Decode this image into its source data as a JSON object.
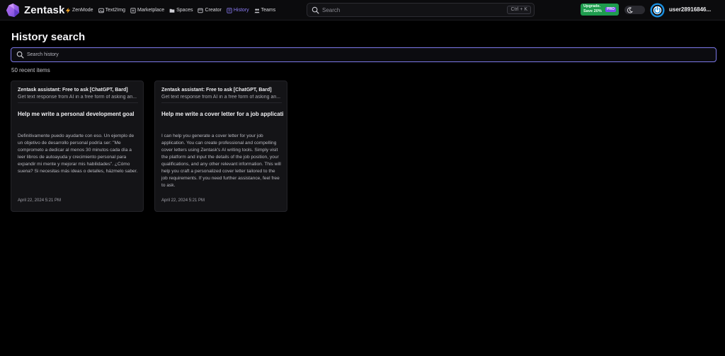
{
  "app": {
    "brand": "Zentask",
    "accent": "#8b7cf6"
  },
  "nav": {
    "items": [
      {
        "label": "ZenMode",
        "icon": "bolt-icon",
        "active": false
      },
      {
        "label": "Text2Img",
        "icon": "image-icon",
        "active": false
      },
      {
        "label": "Marketplace",
        "icon": "marketplace-icon",
        "active": false
      },
      {
        "label": "Spaces",
        "icon": "folder-icon",
        "active": false
      },
      {
        "label": "Creator",
        "icon": "creator-icon",
        "active": false
      },
      {
        "label": "History",
        "icon": "history-icon",
        "active": true
      },
      {
        "label": "Teams",
        "icon": "teams-icon",
        "active": false
      }
    ]
  },
  "search": {
    "placeholder": "Search",
    "shortcut": "Ctrl + K"
  },
  "upgrade": {
    "line1": "Upgrade.",
    "line2": "Save 20%",
    "badge": "PRO",
    "color": "#1e9c4e"
  },
  "user": {
    "name": "user28916846...",
    "avatar_color": "#1a8fe0"
  },
  "page": {
    "title": "History search",
    "search_placeholder": "Search history",
    "count_label": "50 recent items"
  },
  "history": [
    {
      "tool": "Zentask assistant: Free to ask [ChatGPT, Bard]",
      "tool_desc": "Get text response from AI in a free form of asking an...",
      "title": "Help me write a personal development goal",
      "body": "Definitivamente puedo ayudarte con eso. Un ejemplo de un objetivo de desarrollo personal podría ser: \"Me comprometo a dedicar al menos 30 minutos cada día a leer libros de autoayuda y crecimiento personal para expandir mi mente y mejorar mis habilidades\". ¿Cómo suena? Si necesitas más ideas o detalles, házmelo saber.",
      "date": "April 22, 2024 5:21 PM"
    },
    {
      "tool": "Zentask assistant: Free to ask [ChatGPT, Bard]",
      "tool_desc": "Get text response from AI in a free form of asking an...",
      "title": "Help me write a cover letter for a job application",
      "body": "I can help you generate a cover letter for your job application. You can create professional and compelling cover letters using Zentask's AI writing tools. Simply visit the platform and input the details of the job position, your qualifications, and any other relevant information. This will help you craft a personalized cover letter tailored to the job requirements. If you need further assistance, feel free to ask.",
      "date": "April 22, 2024 5:21 PM"
    }
  ]
}
